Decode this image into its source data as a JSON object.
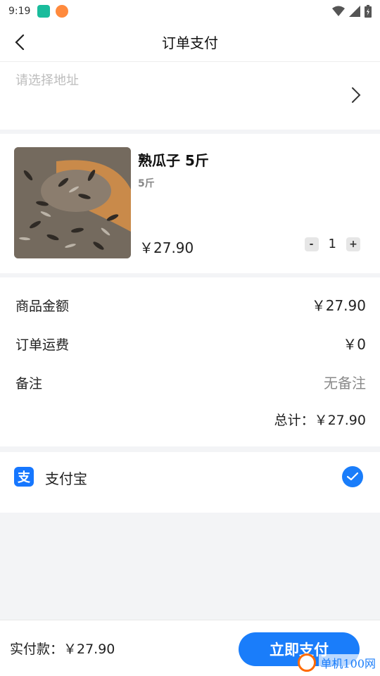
{
  "status_bar": {
    "time": "9:19"
  },
  "header": {
    "title": "订单支付"
  },
  "address": {
    "placeholder": "请选择地址"
  },
  "product": {
    "name": "熟瓜子 5斤",
    "spec": "5斤",
    "price": "￥27.90",
    "quantity": "1",
    "minus_label": "-",
    "plus_label": "+"
  },
  "summary": {
    "rows": [
      {
        "label": "商品金额",
        "value": "￥27.90"
      },
      {
        "label": "订单运费",
        "value": "￥0"
      },
      {
        "label": "备注",
        "value": "无备注"
      }
    ],
    "total": "总计：￥27.90"
  },
  "payment": {
    "logo_char": "支",
    "method": "支付宝",
    "selected": true
  },
  "footer": {
    "amount": "实付款：￥27.90",
    "pay_button": "立即支付"
  },
  "watermark": {
    "text": "单机100网",
    "url": "danji100.com"
  },
  "colors": {
    "accent": "#1a7dfa",
    "alipay": "#1677ff"
  }
}
